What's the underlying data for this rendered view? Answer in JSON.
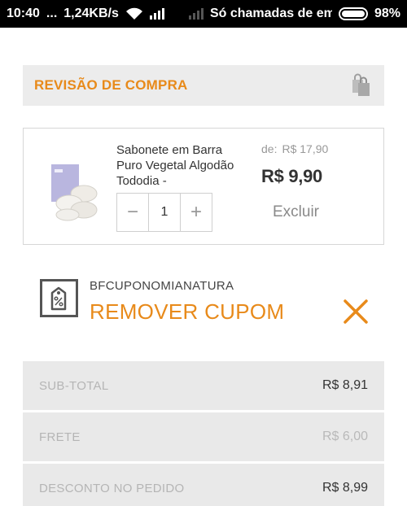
{
  "status_bar": {
    "time": "10:40",
    "dots": "...",
    "speed": "1,24KB/s",
    "carrier": "Só chamadas de em",
    "battery": "98%"
  },
  "header": {
    "title": "REVISÃO DE COMPRA",
    "icon": "shopping-bag-icon"
  },
  "product": {
    "name": "Sabonete em Barra Puro Vegetal Algodão Tododia -",
    "old_price_label": "de:",
    "old_price": "R$ 17,90",
    "price": "R$ 9,90",
    "quantity": "1",
    "minus_label": "−",
    "plus_label": "+",
    "remove_label": "Excluir"
  },
  "coupon": {
    "code": "BFCUPONOMIANATURA",
    "remove_label": "REMOVER CUPOM",
    "icon": "discount-tag-icon"
  },
  "summary": [
    {
      "label": "SUB-TOTAL",
      "value": "R$ 8,91"
    },
    {
      "label": "FRETE",
      "value": "R$ 6,00"
    },
    {
      "label": "DESCONTO NO PEDIDO",
      "value": "R$ 8,99"
    }
  ],
  "colors": {
    "accent": "#e88a1a",
    "panel": "#ececec"
  }
}
